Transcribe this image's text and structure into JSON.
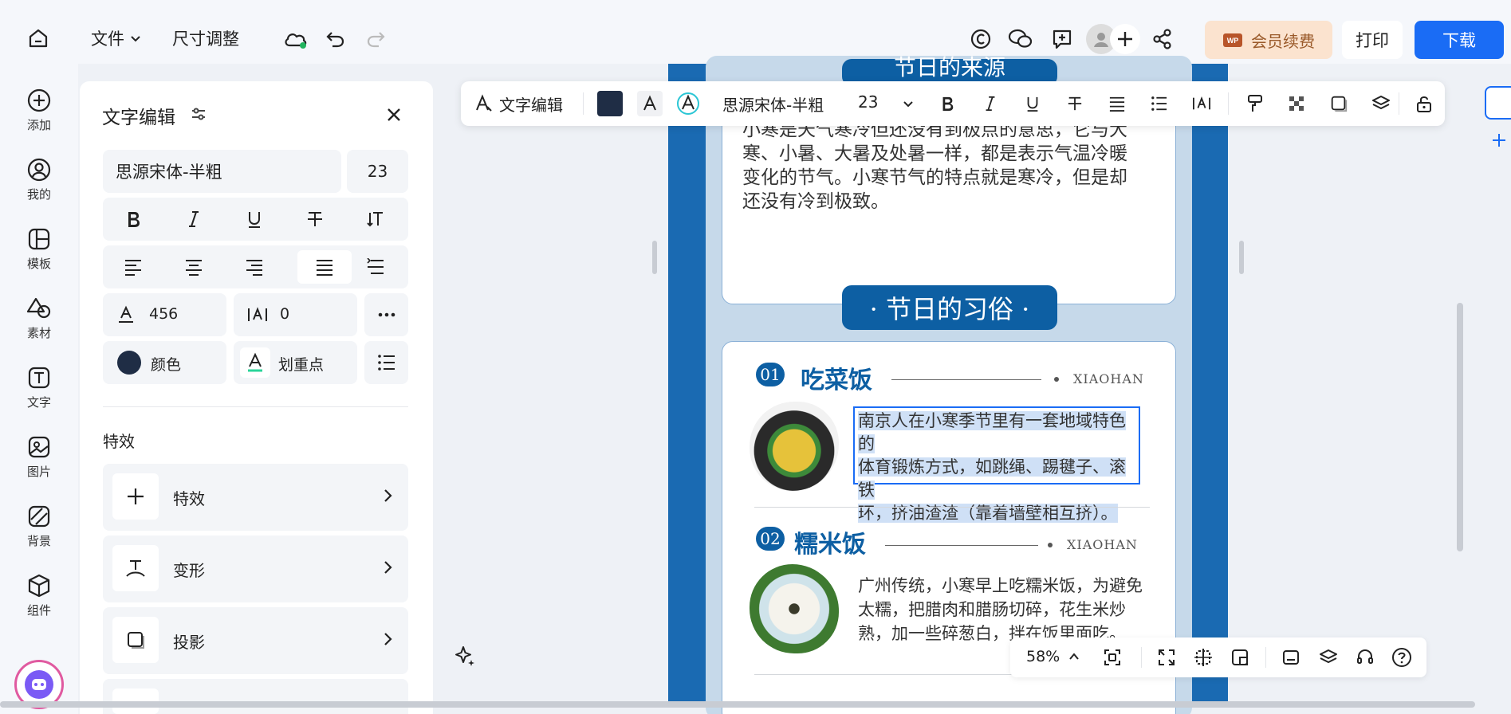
{
  "topbar": {
    "file_menu": "文件",
    "resize": "尺寸调整",
    "vip": "会员续费",
    "print": "打印",
    "download": "下载"
  },
  "rail": {
    "items": [
      {
        "label": "添加",
        "icon": "plus-circle-icon"
      },
      {
        "label": "我的",
        "icon": "user-icon"
      },
      {
        "label": "模板",
        "icon": "template-icon"
      },
      {
        "label": "素材",
        "icon": "shapes-icon"
      },
      {
        "label": "文字",
        "icon": "text-icon"
      },
      {
        "label": "图片",
        "icon": "image-icon"
      },
      {
        "label": "背景",
        "icon": "background-icon"
      },
      {
        "label": "组件",
        "icon": "component-icon"
      }
    ]
  },
  "panel": {
    "title": "文字编辑",
    "font_name": "思源宋体-半粗",
    "font_size": "23",
    "letter_spacing": "456",
    "line_spacing": "0",
    "color_label": "颜色",
    "underline_point_label": "划重点",
    "effects_section": "特效",
    "effect_rows": [
      "特效",
      "变形",
      "投影"
    ]
  },
  "toolbar": {
    "text_edit": "文字编辑",
    "font_name": "思源宋体-半粗",
    "font_size": "23"
  },
  "canvas": {
    "top_heading": "节日的来源",
    "top_paragraph_lines": [
      "小寒是天气寒冷但还没有到极点的意思，它与大",
      "寒、小暑、大暑及处暑一样，都是表示气温冷暖",
      "变化的节气。小寒节气的特点就是寒冷，但是却",
      "还没有冷到极致。"
    ],
    "section_heading": "· 节日的习俗 ·",
    "items": [
      {
        "num": "01",
        "title": "吃菜饭",
        "tag": "XIAOHAN",
        "lines": [
          "南京人在小寒季节里有一套地域特色的",
          "体育锻炼方式，如跳绳、踢毽子、滚铁",
          "环，挤油渣渣（靠着墙壁相互挤）。"
        ]
      },
      {
        "num": "02",
        "title": "糯米饭",
        "tag": "XIAOHAN",
        "lines": [
          "广州传统，小寒早上吃糯米饭，为避免",
          "太糯，把腊肉和腊肠切碎，花生米炒",
          "熟，加一些碎葱白，拌在饭里面吃。"
        ]
      }
    ]
  },
  "bottombar": {
    "zoom": "58%"
  },
  "colors": {
    "accent": "#1a6cf5",
    "canvas_blue": "#1a6ab2",
    "vip_bg": "#fbe3cf"
  }
}
